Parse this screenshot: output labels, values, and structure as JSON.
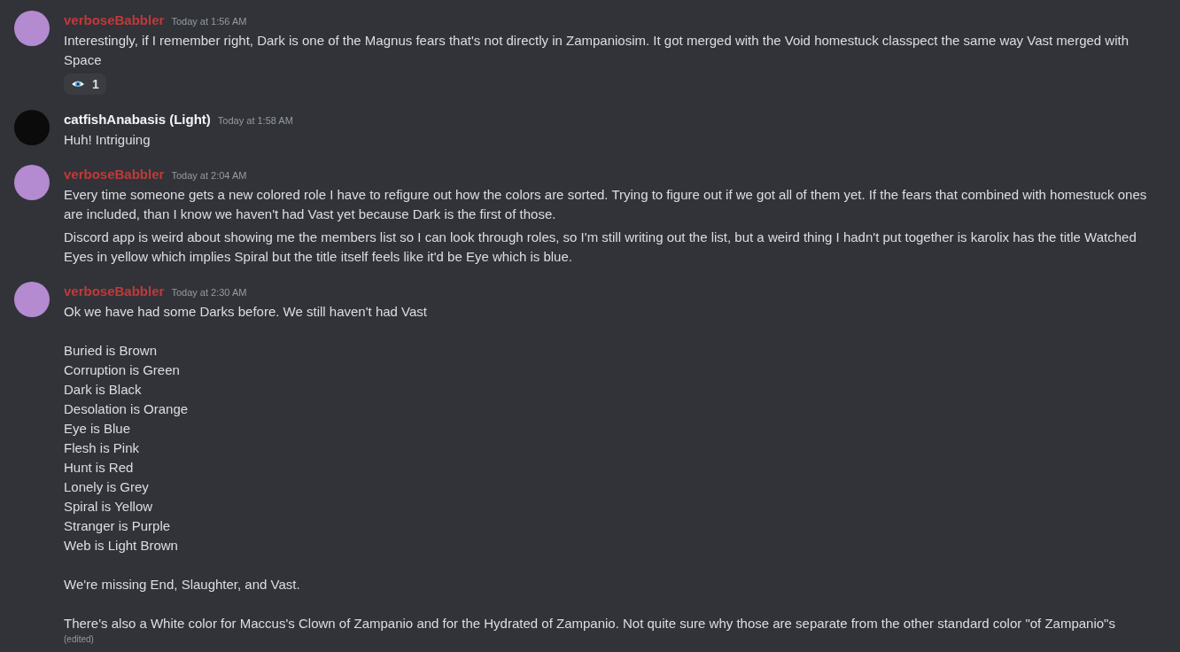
{
  "messages": [
    {
      "author": "verboseBabbler",
      "color": "#c03a3a",
      "avatar": {
        "color": "#b48ad0"
      },
      "time": "Today at 1:56 AM",
      "blocks": [
        [
          "Interestingly, if I remember right, Dark is one of the Magnus fears that's not directly in Zampaniosim. It got merged with the Void homestuck classpect the same way Vast merged with Space"
        ]
      ],
      "reactions": [
        {
          "count": "1"
        }
      ]
    },
    {
      "author": "catfishAnabasis (Light)",
      "color": "#f2f3f5",
      "avatar": {
        "color": "#0b0b0b"
      },
      "time": "Today at 1:58 AM",
      "blocks": [
        [
          "Huh! Intriguing"
        ]
      ]
    },
    {
      "author": "verboseBabbler",
      "color": "#c03a3a",
      "avatar": {
        "color": "#b48ad0"
      },
      "time": "Today at 2:04 AM",
      "blocks": [
        [
          "Every time someone gets a new colored role I have to refigure out how the colors are sorted. Trying to figure out if we got all of them yet. If the fears that combined with homestuck ones are included, than I know we haven't had Vast yet because Dark is the first of those."
        ],
        [
          "Discord app is weird about showing me the members list so I can look through roles, so I'm still writing out the list, but a weird thing I hadn't put together is karolix has the title Watched Eyes in yellow which implies Spiral but the title itself feels like it'd be Eye which is blue."
        ]
      ]
    },
    {
      "author": "verboseBabbler",
      "color": "#c03a3a",
      "avatar": {
        "color": "#b48ad0"
      },
      "time": "Today at 2:30 AM",
      "blocks": [
        [
          "Ok we have had some Darks before. We still haven't had Vast"
        ],
        [
          "Buried is Brown",
          "Corruption is Green",
          "Dark is Black",
          "Desolation is Orange",
          "Eye is Blue",
          "Flesh is Pink",
          "Hunt is Red",
          "Lonely is Grey",
          "Spiral is Yellow",
          "Stranger is Purple",
          "Web is Light Brown"
        ],
        [
          "We're missing End, Slaughter, and Vast."
        ],
        [
          "There's also a White color for Maccus's Clown of Zampanio and for the Hydrated of Zampanio. Not quite sure why those are separate from the other standard color \"of Zampanio\"s"
        ]
      ],
      "edited": "(edited)"
    }
  ]
}
